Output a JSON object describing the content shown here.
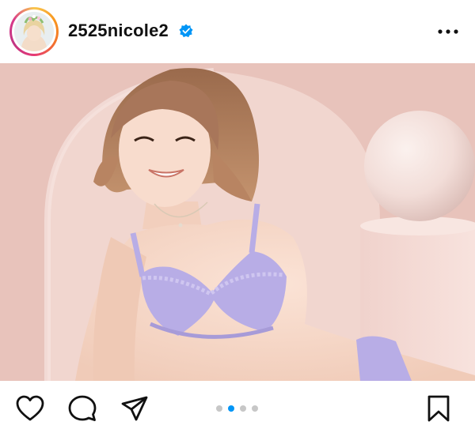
{
  "post": {
    "username": "2525nicole2",
    "verified": true,
    "verified_icon": "verified-badge-icon",
    "more_icon": "more-options-icon"
  },
  "carousel": {
    "count": 4,
    "active_index": 1
  },
  "actions": {
    "like_icon": "heart-icon",
    "comment_icon": "comment-icon",
    "share_icon": "send-icon",
    "save_icon": "bookmark-icon"
  },
  "colors": {
    "accent": "#0095f6",
    "inactive_dot": "#c7c7c7",
    "backdrop": "#e9c4bd",
    "lingerie": "#b8ade6"
  }
}
